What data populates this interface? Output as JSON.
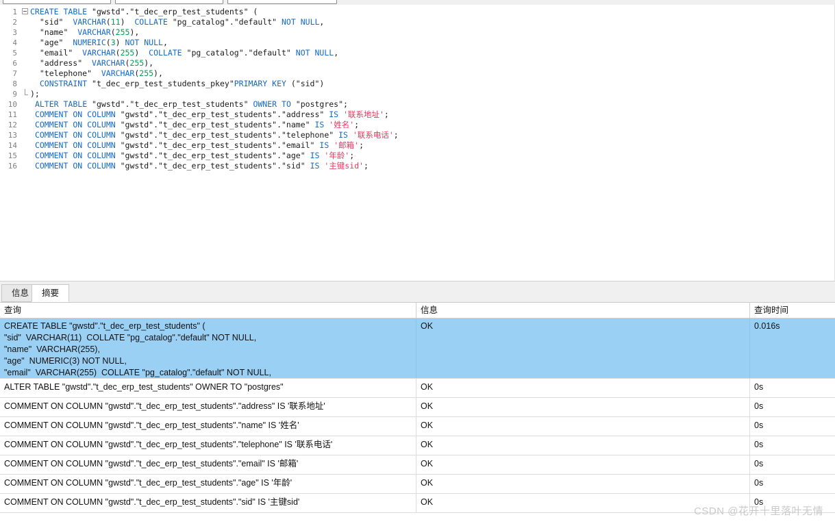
{
  "toolbar": {
    "combo_1_value": "",
    "combo_2_value": "",
    "combo_3_value": ""
  },
  "editor": {
    "language": "sql",
    "lines": [
      {
        "number": "1",
        "fold": "start",
        "tokens": [
          {
            "t": "CREATE",
            "c": "kw"
          },
          {
            "t": " ",
            "c": "plain"
          },
          {
            "t": "TABLE",
            "c": "kw"
          },
          {
            "t": " \"gwstd\".\"t_dec_erp_test_students\" (",
            "c": "plain"
          }
        ]
      },
      {
        "number": "2",
        "fold": "bar",
        "tokens": [
          {
            "t": "  \"sid\"  ",
            "c": "plain"
          },
          {
            "t": "VARCHAR",
            "c": "kw"
          },
          {
            "t": "(",
            "c": "plain"
          },
          {
            "t": "11",
            "c": "num"
          },
          {
            "t": ")  ",
            "c": "plain"
          },
          {
            "t": "COLLATE",
            "c": "kw"
          },
          {
            "t": " \"pg_catalog\".\"default\" ",
            "c": "plain"
          },
          {
            "t": "NOT",
            "c": "kw"
          },
          {
            "t": " ",
            "c": "plain"
          },
          {
            "t": "NULL",
            "c": "kw"
          },
          {
            "t": ",",
            "c": "plain"
          }
        ]
      },
      {
        "number": "3",
        "fold": "bar",
        "tokens": [
          {
            "t": "  \"name\"  ",
            "c": "plain"
          },
          {
            "t": "VARCHAR",
            "c": "kw"
          },
          {
            "t": "(",
            "c": "plain"
          },
          {
            "t": "255",
            "c": "num"
          },
          {
            "t": "),",
            "c": "plain"
          }
        ]
      },
      {
        "number": "4",
        "fold": "bar",
        "tokens": [
          {
            "t": "  \"age\"  ",
            "c": "plain"
          },
          {
            "t": "NUMERIC",
            "c": "kw"
          },
          {
            "t": "(",
            "c": "plain"
          },
          {
            "t": "3",
            "c": "num"
          },
          {
            "t": ") ",
            "c": "plain"
          },
          {
            "t": "NOT",
            "c": "kw"
          },
          {
            "t": " ",
            "c": "plain"
          },
          {
            "t": "NULL",
            "c": "kw"
          },
          {
            "t": ",",
            "c": "plain"
          }
        ]
      },
      {
        "number": "5",
        "fold": "bar",
        "tokens": [
          {
            "t": "  \"email\"  ",
            "c": "plain"
          },
          {
            "t": "VARCHAR",
            "c": "kw"
          },
          {
            "t": "(",
            "c": "plain"
          },
          {
            "t": "255",
            "c": "num"
          },
          {
            "t": ")  ",
            "c": "plain"
          },
          {
            "t": "COLLATE",
            "c": "kw"
          },
          {
            "t": " \"pg_catalog\".\"default\" ",
            "c": "plain"
          },
          {
            "t": "NOT",
            "c": "kw"
          },
          {
            "t": " ",
            "c": "plain"
          },
          {
            "t": "NULL",
            "c": "kw"
          },
          {
            "t": ",",
            "c": "plain"
          }
        ]
      },
      {
        "number": "6",
        "fold": "bar",
        "tokens": [
          {
            "t": "  \"address\"  ",
            "c": "plain"
          },
          {
            "t": "VARCHAR",
            "c": "kw"
          },
          {
            "t": "(",
            "c": "plain"
          },
          {
            "t": "255",
            "c": "num"
          },
          {
            "t": "),",
            "c": "plain"
          }
        ]
      },
      {
        "number": "7",
        "fold": "bar",
        "tokens": [
          {
            "t": "  \"telephone\"  ",
            "c": "plain"
          },
          {
            "t": "VARCHAR",
            "c": "kw"
          },
          {
            "t": "(",
            "c": "plain"
          },
          {
            "t": "255",
            "c": "num"
          },
          {
            "t": "),",
            "c": "plain"
          }
        ]
      },
      {
        "number": "8",
        "fold": "bar",
        "tokens": [
          {
            "t": "  ",
            "c": "plain"
          },
          {
            "t": "CONSTRAINT",
            "c": "kw"
          },
          {
            "t": " \"t_dec_erp_test_students_pkey\"",
            "c": "plain"
          },
          {
            "t": "PRIMARY",
            "c": "kw"
          },
          {
            "t": " ",
            "c": "plain"
          },
          {
            "t": "KEY",
            "c": "kw"
          },
          {
            "t": " (\"sid\")",
            "c": "plain"
          }
        ]
      },
      {
        "number": "9",
        "fold": "end",
        "tokens": [
          {
            "t": ");",
            "c": "plain"
          }
        ]
      },
      {
        "number": "10",
        "fold": "none",
        "tokens": [
          {
            "t": " ",
            "c": "plain"
          },
          {
            "t": "ALTER",
            "c": "kw"
          },
          {
            "t": " ",
            "c": "plain"
          },
          {
            "t": "TABLE",
            "c": "kw"
          },
          {
            "t": " \"gwstd\".\"t_dec_erp_test_students\" ",
            "c": "plain"
          },
          {
            "t": "OWNER",
            "c": "kw"
          },
          {
            "t": " ",
            "c": "plain"
          },
          {
            "t": "TO",
            "c": "kw"
          },
          {
            "t": " \"postgres\";",
            "c": "plain"
          }
        ]
      },
      {
        "number": "11",
        "fold": "none",
        "tokens": [
          {
            "t": " ",
            "c": "plain"
          },
          {
            "t": "COMMENT",
            "c": "kw"
          },
          {
            "t": " ",
            "c": "plain"
          },
          {
            "t": "ON",
            "c": "kw"
          },
          {
            "t": " ",
            "c": "plain"
          },
          {
            "t": "COLUMN",
            "c": "kw"
          },
          {
            "t": " \"gwstd\".\"t_dec_erp_test_students\".\"address\" ",
            "c": "plain"
          },
          {
            "t": "IS",
            "c": "kw"
          },
          {
            "t": " ",
            "c": "plain"
          },
          {
            "t": "'联系地址'",
            "c": "str"
          },
          {
            "t": ";",
            "c": "plain"
          }
        ]
      },
      {
        "number": "12",
        "fold": "none",
        "tokens": [
          {
            "t": " ",
            "c": "plain"
          },
          {
            "t": "COMMENT",
            "c": "kw"
          },
          {
            "t": " ",
            "c": "plain"
          },
          {
            "t": "ON",
            "c": "kw"
          },
          {
            "t": " ",
            "c": "plain"
          },
          {
            "t": "COLUMN",
            "c": "kw"
          },
          {
            "t": " \"gwstd\".\"t_dec_erp_test_students\".\"name\" ",
            "c": "plain"
          },
          {
            "t": "IS",
            "c": "kw"
          },
          {
            "t": " ",
            "c": "plain"
          },
          {
            "t": "'姓名'",
            "c": "str"
          },
          {
            "t": ";",
            "c": "plain"
          }
        ]
      },
      {
        "number": "13",
        "fold": "none",
        "tokens": [
          {
            "t": " ",
            "c": "plain"
          },
          {
            "t": "COMMENT",
            "c": "kw"
          },
          {
            "t": " ",
            "c": "plain"
          },
          {
            "t": "ON",
            "c": "kw"
          },
          {
            "t": " ",
            "c": "plain"
          },
          {
            "t": "COLUMN",
            "c": "kw"
          },
          {
            "t": " \"gwstd\".\"t_dec_erp_test_students\".\"telephone\" ",
            "c": "plain"
          },
          {
            "t": "IS",
            "c": "kw"
          },
          {
            "t": " ",
            "c": "plain"
          },
          {
            "t": "'联系电话'",
            "c": "str"
          },
          {
            "t": ";",
            "c": "plain"
          }
        ]
      },
      {
        "number": "14",
        "fold": "none",
        "tokens": [
          {
            "t": " ",
            "c": "plain"
          },
          {
            "t": "COMMENT",
            "c": "kw"
          },
          {
            "t": " ",
            "c": "plain"
          },
          {
            "t": "ON",
            "c": "kw"
          },
          {
            "t": " ",
            "c": "plain"
          },
          {
            "t": "COLUMN",
            "c": "kw"
          },
          {
            "t": " \"gwstd\".\"t_dec_erp_test_students\".\"email\" ",
            "c": "plain"
          },
          {
            "t": "IS",
            "c": "kw"
          },
          {
            "t": " ",
            "c": "plain"
          },
          {
            "t": "'邮箱'",
            "c": "str"
          },
          {
            "t": ";",
            "c": "plain"
          }
        ]
      },
      {
        "number": "15",
        "fold": "none",
        "tokens": [
          {
            "t": " ",
            "c": "plain"
          },
          {
            "t": "COMMENT",
            "c": "kw"
          },
          {
            "t": " ",
            "c": "plain"
          },
          {
            "t": "ON",
            "c": "kw"
          },
          {
            "t": " ",
            "c": "plain"
          },
          {
            "t": "COLUMN",
            "c": "kw"
          },
          {
            "t": " \"gwstd\".\"t_dec_erp_test_students\".\"age\" ",
            "c": "plain"
          },
          {
            "t": "IS",
            "c": "kw"
          },
          {
            "t": " ",
            "c": "plain"
          },
          {
            "t": "'年龄'",
            "c": "str"
          },
          {
            "t": ";",
            "c": "plain"
          }
        ]
      },
      {
        "number": "16",
        "fold": "none",
        "tokens": [
          {
            "t": " ",
            "c": "plain"
          },
          {
            "t": "COMMENT",
            "c": "kw"
          },
          {
            "t": " ",
            "c": "plain"
          },
          {
            "t": "ON",
            "c": "kw"
          },
          {
            "t": " ",
            "c": "plain"
          },
          {
            "t": "COLUMN",
            "c": "kw"
          },
          {
            "t": " \"gwstd\".\"t_dec_erp_test_students\".\"sid\" ",
            "c": "plain"
          },
          {
            "t": "IS",
            "c": "kw"
          },
          {
            "t": " ",
            "c": "plain"
          },
          {
            "t": "'主键sid'",
            "c": "str"
          },
          {
            "t": ";",
            "c": "plain"
          }
        ]
      }
    ]
  },
  "tabs": [
    {
      "label": "信息",
      "active": false
    },
    {
      "label": "摘要",
      "active": true
    }
  ],
  "results": {
    "columns": [
      "查询",
      "信息",
      "查询时间"
    ],
    "rows": [
      {
        "query": "CREATE TABLE \"gwstd\".\"t_dec_erp_test_students\" (\n\"sid\"  VARCHAR(11)  COLLATE \"pg_catalog\".\"default\" NOT NULL,\n\"name\"  VARCHAR(255),\n\"age\"  NUMERIC(3) NOT NULL,\n\"email\"  VARCHAR(255)  COLLATE \"pg_catalog\".\"default\" NOT NULL,",
        "message": "OK",
        "time": "0.016s",
        "selected": true,
        "tall": true
      },
      {
        "query": "ALTER TABLE \"gwstd\".\"t_dec_erp_test_students\" OWNER TO \"postgres\"",
        "message": "OK",
        "time": "0s",
        "selected": false,
        "tall": false
      },
      {
        "query": "COMMENT ON COLUMN \"gwstd\".\"t_dec_erp_test_students\".\"address\" IS '联系地址'",
        "message": "OK",
        "time": "0s",
        "selected": false,
        "tall": false
      },
      {
        "query": "COMMENT ON COLUMN \"gwstd\".\"t_dec_erp_test_students\".\"name\" IS '姓名'",
        "message": "OK",
        "time": "0s",
        "selected": false,
        "tall": false
      },
      {
        "query": "COMMENT ON COLUMN \"gwstd\".\"t_dec_erp_test_students\".\"telephone\" IS '联系电话'",
        "message": "OK",
        "time": "0s",
        "selected": false,
        "tall": false
      },
      {
        "query": "COMMENT ON COLUMN \"gwstd\".\"t_dec_erp_test_students\".\"email\" IS '邮箱'",
        "message": "OK",
        "time": "0s",
        "selected": false,
        "tall": false
      },
      {
        "query": "COMMENT ON COLUMN \"gwstd\".\"t_dec_erp_test_students\".\"age\" IS '年龄'",
        "message": "OK",
        "time": "0s",
        "selected": false,
        "tall": false
      },
      {
        "query": "COMMENT ON COLUMN \"gwstd\".\"t_dec_erp_test_students\".\"sid\" IS '主键sid'",
        "message": "OK",
        "time": "0s",
        "selected": false,
        "tall": false
      }
    ]
  },
  "watermark": {
    "text": "CSDN @花开十里落叶无情"
  },
  "colors": {
    "keyword": "#1569C7",
    "number": "#00A050",
    "string": "#E8395E",
    "selection": "#9BD0F5",
    "toolbar_bg": "#F0F0F0"
  }
}
